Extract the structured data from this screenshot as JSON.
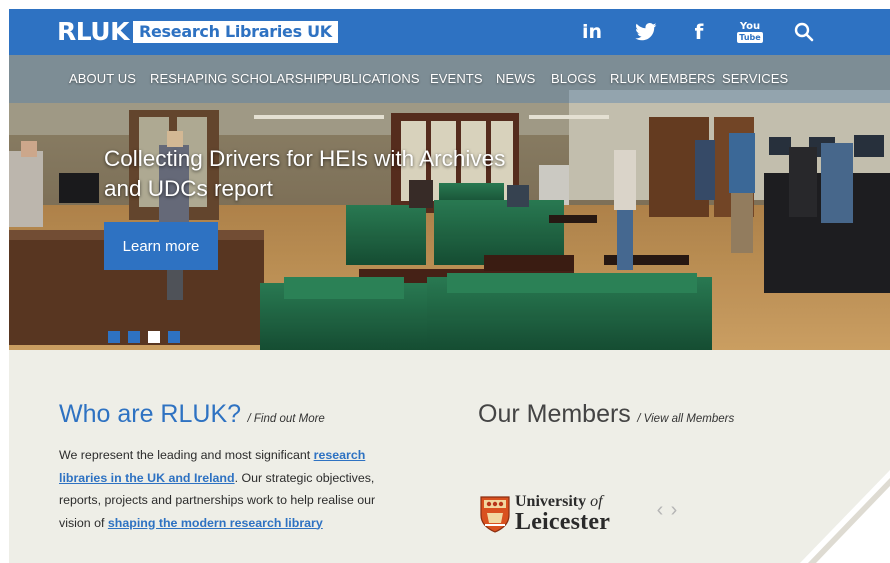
{
  "header": {
    "logo_mark": "RLUK",
    "logo_text": "Research Libraries UK",
    "social": {
      "linkedin_label": "in",
      "facebook_label": "f",
      "youtube_you": "You",
      "youtube_tube": "Tube"
    }
  },
  "nav": {
    "items": [
      "ABOUT US",
      "RESHAPING SCHOLARSHIP",
      "PUBLICATIONS",
      "EVENTS",
      "NEWS",
      "BLOGS",
      "RLUK MEMBERS",
      "SERVICES"
    ]
  },
  "hero": {
    "title": "Collecting Drivers for HEIs with Archives and UDCs report",
    "button_label": "Learn more",
    "slide_count": 4,
    "active_slide": 3
  },
  "who": {
    "heading": "Who are RLUK?",
    "link_label": "/ Find out More",
    "text_1": "We represent the leading and most significant ",
    "link_1": "research libraries in the UK and Ireland",
    "text_2": ". Our strategic objectives, reports, projects and partnerships work to help realise our vision of ",
    "link_2": "shaping the modern research library"
  },
  "members": {
    "heading": "Our Members",
    "link_label": "/ View all Members",
    "logo_line1_bold": "University",
    "logo_line1_italic": "of",
    "logo_line2": "Leicester",
    "prev_arrow": "‹",
    "next_arrow": "›"
  },
  "colors": {
    "brand_blue": "#2e72c2",
    "page_background": "#eeeee7",
    "sofa_green": "#1f6b45"
  },
  "icons": [
    "linkedin-icon",
    "twitter-icon",
    "facebook-icon",
    "youtube-icon",
    "search-icon",
    "shield-crest-icon",
    "chevron-left-icon",
    "chevron-right-icon"
  ]
}
